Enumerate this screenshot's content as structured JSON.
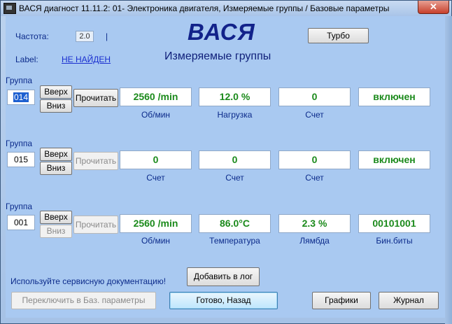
{
  "window": {
    "title": "ВАСЯ диагност 11.11.2: 01- Электроника двигателя,  Измеряемые группы / Базовые параметры",
    "close_label": "✕"
  },
  "header": {
    "freq_label": "Частота:",
    "freq_value": "2.0",
    "freq_marker": "|",
    "label_label": "Label:",
    "label_value": "НЕ НАЙДЕН",
    "app_name": "ВАСЯ",
    "subtitle": "Измеряемые группы",
    "turbo_label": "Турбо"
  },
  "groups": [
    {
      "label": "Группа",
      "number": "014",
      "up": "Вверх",
      "down": "Вниз",
      "read": "Прочитать",
      "values": [
        "2560 /min",
        "12.0 %",
        "0",
        "включен"
      ],
      "captions": [
        "Об/мин",
        "Нагрузка",
        "Счет",
        ""
      ]
    },
    {
      "label": "Группа",
      "number": "015",
      "up": "Вверх",
      "down": "Вниз",
      "read": "Прочитать",
      "values": [
        "0",
        "0",
        "0",
        "включен"
      ],
      "captions": [
        "Счет",
        "Счет",
        "Счет",
        ""
      ]
    },
    {
      "label": "Группа",
      "number": "001",
      "up": "Вверх",
      "down": "Вниз",
      "read": "Прочитать",
      "values": [
        "2560 /min",
        "86.0°C",
        "2.3 %",
        "00101001"
      ],
      "captions": [
        "Об/мин",
        "Температура",
        "Лямбда",
        "Бин.биты"
      ]
    }
  ],
  "footer": {
    "hint": "Используйте сервисную документацию!",
    "add_log": "Добавить в лог",
    "switch_basic": "Переключить в Баз. параметры",
    "done_back": "Готово, Назад",
    "graphs": "Графики",
    "journal": "Журнал"
  }
}
